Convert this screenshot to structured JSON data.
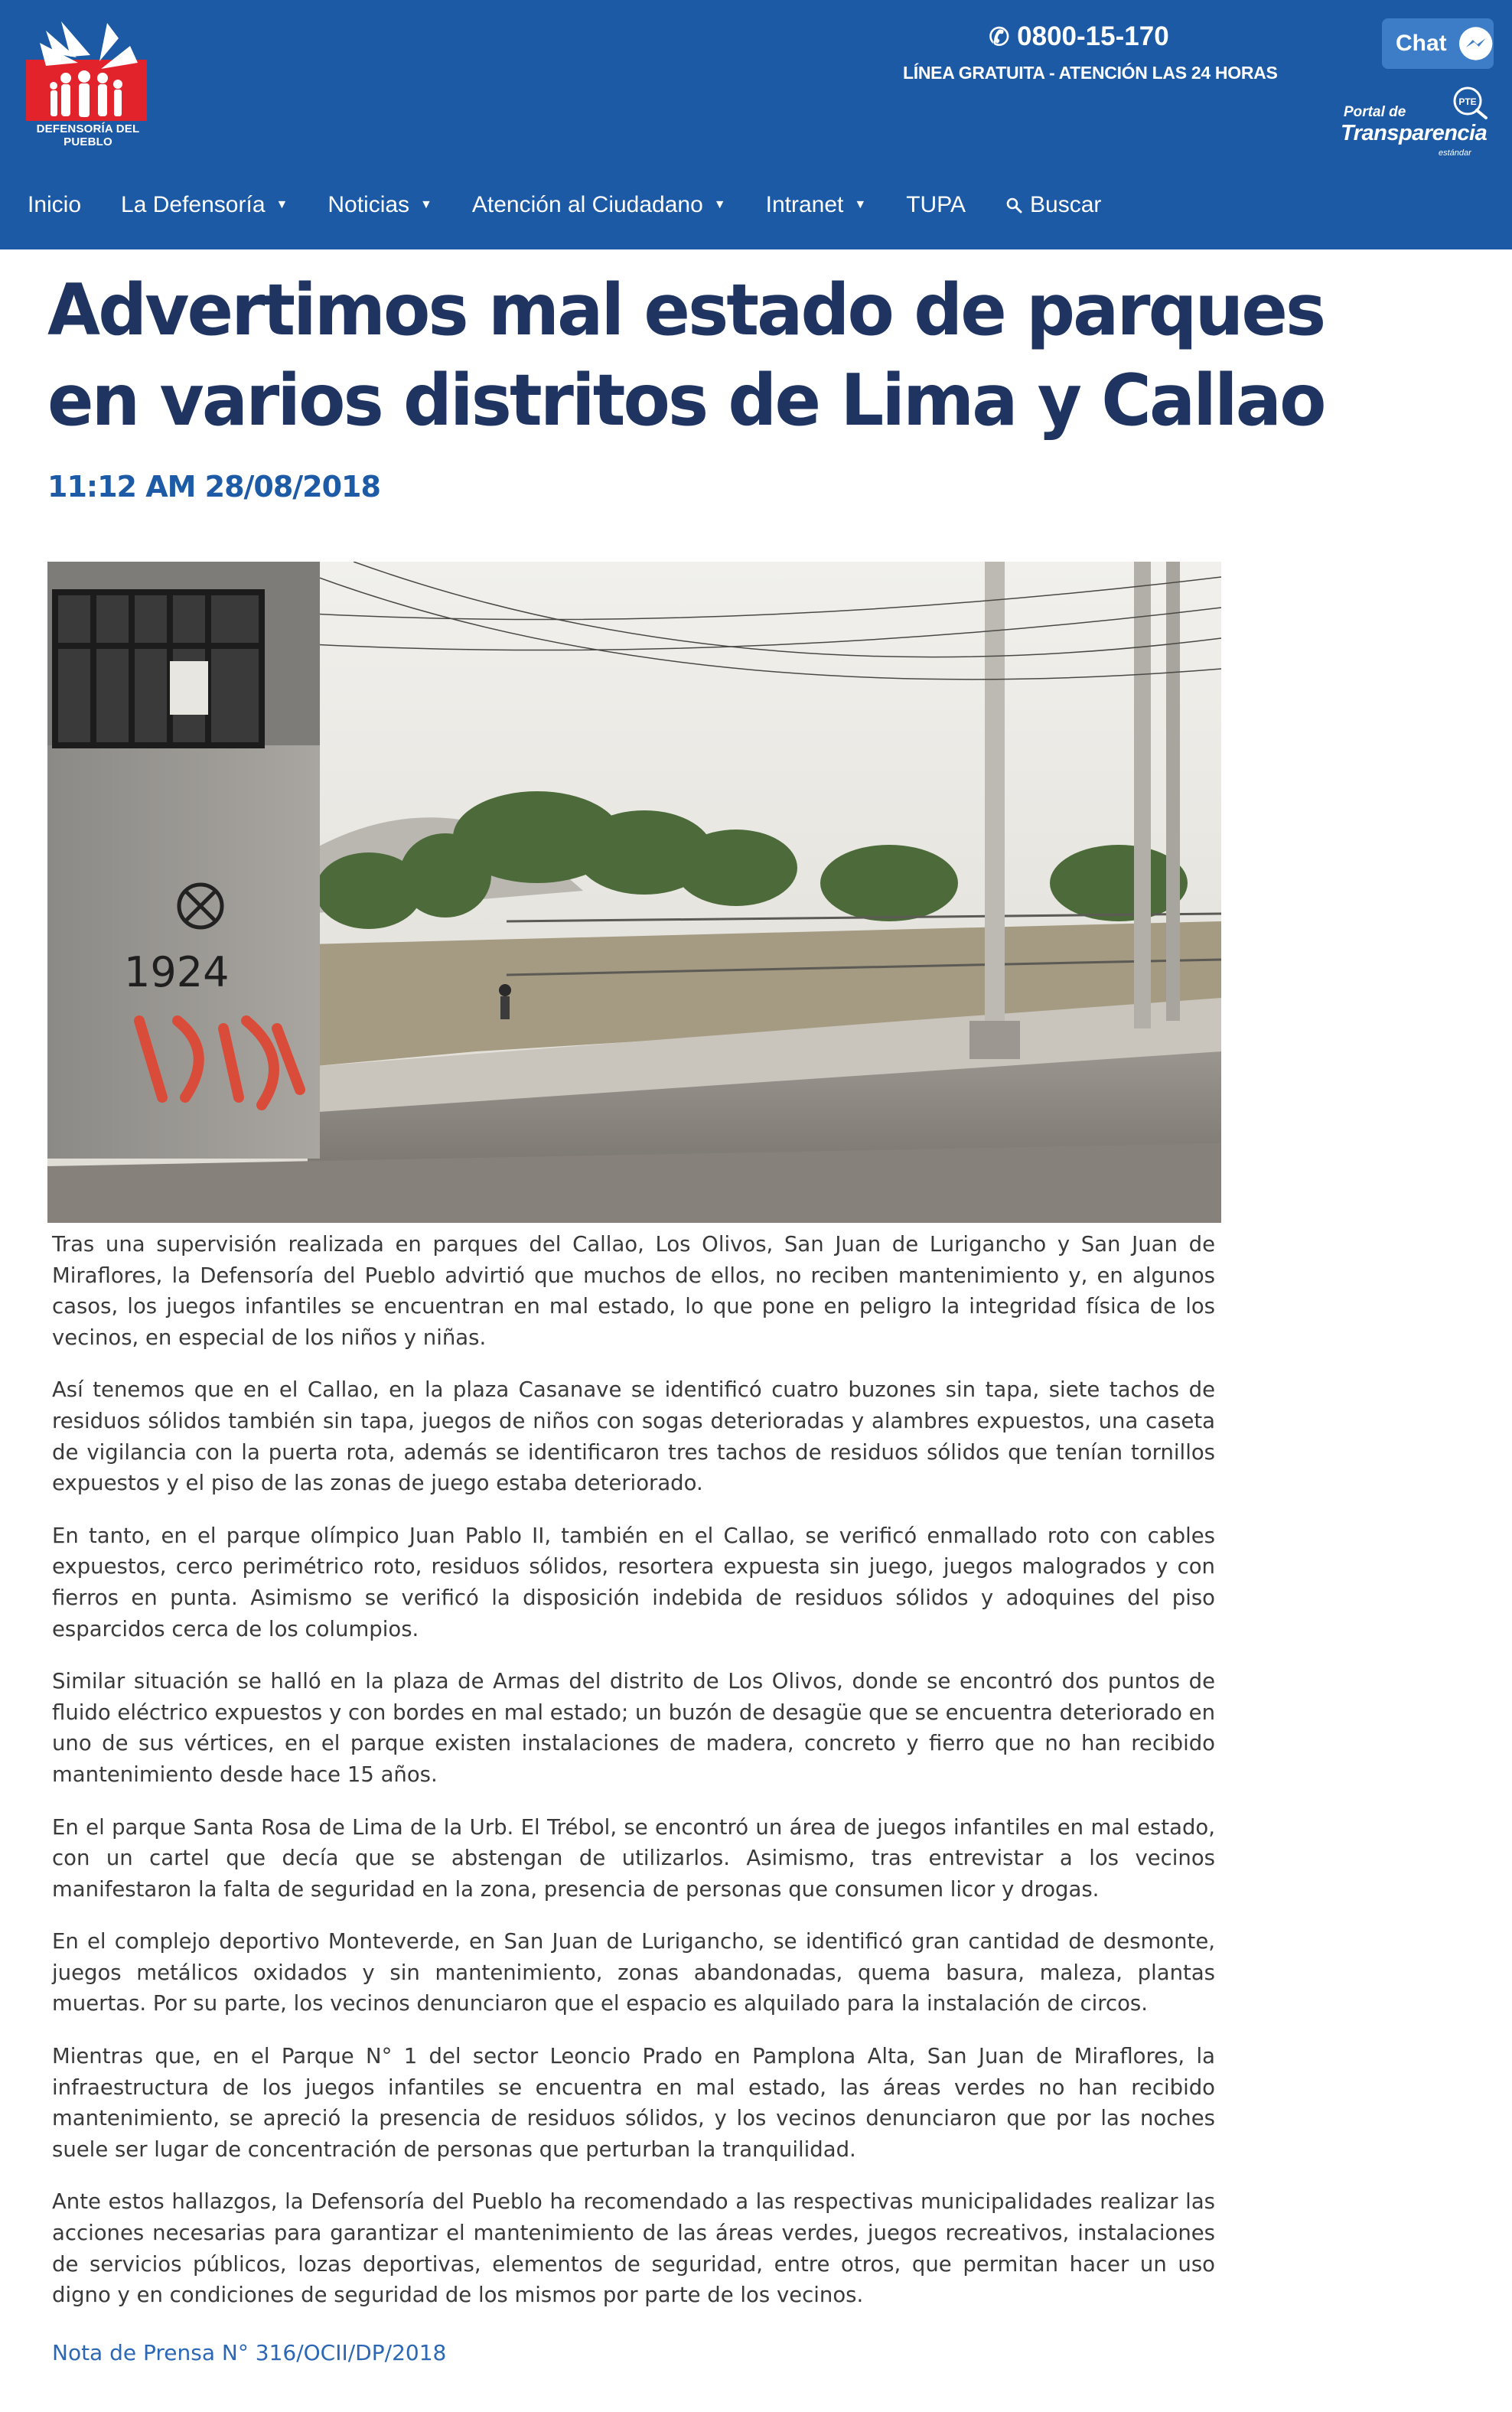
{
  "header": {
    "logo_text": "DEFENSORÍA DEL PUEBLO",
    "phone_icon": "phone-icon",
    "hotline_number": "0800-15-170",
    "hotline_subtitle": "LÍNEA GRATUITA - ATENCIÓN LAS 24 HORAS",
    "chat_label": "Chat",
    "chat_icon": "messenger-icon",
    "transparency": {
      "line1": "Portal de",
      "line2": "Transparencia",
      "line3": "estándar",
      "badge": "PTE"
    },
    "brand_color": "#1c5aa5"
  },
  "nav": {
    "items": [
      {
        "label": "Inicio",
        "has_dropdown": false
      },
      {
        "label": "La Defensoría",
        "has_dropdown": true
      },
      {
        "label": "Noticias",
        "has_dropdown": true
      },
      {
        "label": "Atención al Ciudadano",
        "has_dropdown": true
      },
      {
        "label": "Intranet",
        "has_dropdown": true
      },
      {
        "label": "TUPA",
        "has_dropdown": false
      },
      {
        "label": "Buscar",
        "has_dropdown": false,
        "icon": "search-icon"
      }
    ]
  },
  "article": {
    "title": "Advertimos mal estado de parques en varios distritos de Lima y Callao",
    "timestamp": "11:12 AM 28/08/2018",
    "paragraphs": [
      "Tras una supervisión realizada en parques del Callao, Los Olivos, San Juan de Lurigancho y San Juan de Miraflores, la Defensoría del Pueblo advirtió que muchos de ellos, no reciben mantenimiento y, en algunos casos, los juegos infantiles se encuentran en mal estado, lo que pone en peligro la integridad física de los vecinos, en especial de los niños y niñas.",
      "Así tenemos que en el Callao, en la plaza Casanave se identificó cuatro buzones sin tapa, siete tachos de residuos sólidos también sin tapa, juegos de niños con sogas deterioradas y alambres expuestos, una caseta de vigilancia con la puerta rota, además se identificaron tres tachos de residuos sólidos que tenían tornillos expuestos y el piso de las zonas de juego estaba deteriorado.",
      "En tanto, en el parque olímpico Juan Pablo II, también en el Callao, se verificó enmallado roto con cables expuestos, cerco perimétrico roto, residuos sólidos, resortera expuesta sin juego, juegos malogrados y con fierros en punta. Asimismo se verificó la disposición indebida de residuos sólidos y adoquines del piso esparcidos cerca de los columpios.",
      "Similar situación se halló en la plaza de Armas del distrito de Los Olivos, donde se encontró dos puntos de fluido eléctrico expuestos y con bordes en mal estado; un buzón de desagüe que se encuentra deteriorado en uno de sus vértices, en el parque existen instalaciones de madera, concreto y fierro que no han recibido mantenimiento desde hace 15 años.",
      "En el parque Santa Rosa de Lima de la Urb. El Trébol, se encontró un área de juegos infantiles en mal estado, con un cartel que decía que se abstengan de utilizarlos. Asimismo, tras entrevistar a los vecinos manifestaron la falta de seguridad en la zona, presencia de personas que consumen licor y drogas.",
      "En el complejo deportivo Monteverde, en San Juan de Lurigancho, se identificó gran cantidad de desmonte, juegos metálicos oxidados y sin mantenimiento, zonas abandonadas, quema basura, maleza, plantas muertas. Por su parte, los vecinos denunciaron que el espacio es alquilado para la instalación de circos.",
      "Mientras que, en el Parque N° 1 del sector Leoncio Prado en Pamplona Alta, San Juan de Miraflores, la infraestructura de los juegos infantiles se encuentra en mal estado, las áreas verdes no han recibido mantenimiento, se apreció la presencia de residuos sólidos, y los vecinos denunciaron que por las noches suele ser lugar de concentración de personas que perturban la tranquilidad.",
      "Ante estos hallazgos, la Defensoría del Pueblo ha recomendado a las respectivas municipalidades realizar las acciones necesarias para garantizar el mantenimiento de las áreas verdes, juegos recreativos, instalaciones de servicios públicos, lozas deportivas, elementos de seguridad, entre otros, que permitan hacer un uso digno y en condiciones de seguridad de los mismos por parte de los vecinos."
    ],
    "press_note": "Nota de Prensa N° 316/OCII/DP/2018",
    "photo_graffiti": "1924"
  }
}
